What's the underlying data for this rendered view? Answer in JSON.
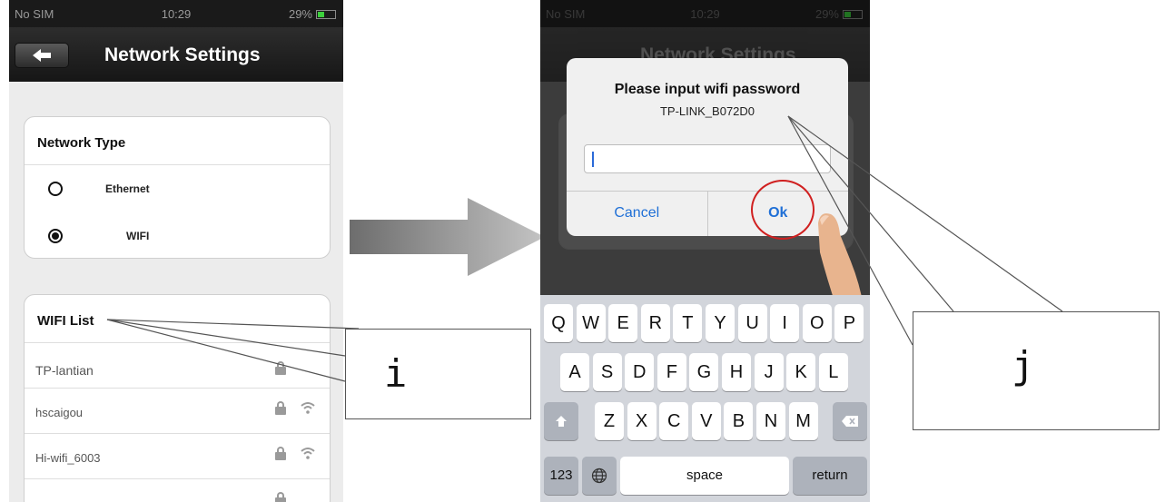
{
  "left_phone": {
    "status": {
      "carrier": "No SIM",
      "time": "10:29",
      "battery": "29%"
    },
    "nav": {
      "back_icon": "back-arrow-icon",
      "title": "Network Settings"
    },
    "network_type": {
      "heading": "Network Type",
      "options": [
        {
          "label": "Ethernet",
          "selected": false
        },
        {
          "label": "WIFI",
          "selected": true
        }
      ]
    },
    "wifi_list": {
      "heading": "WIFI List",
      "networks": [
        {
          "ssid": "TP-lantian"
        },
        {
          "ssid": "hscaigou"
        },
        {
          "ssid": "Hi-wifi_6003"
        }
      ]
    }
  },
  "right_phone": {
    "status": {
      "carrier": "No SIM",
      "time": "10:29",
      "battery": "29%"
    },
    "nav": {
      "title": "Network Settings"
    },
    "dialog": {
      "title": "Please input wifi password",
      "ssid": "TP-LINK_B072D0",
      "password_value": "",
      "cancel_label": "Cancel",
      "ok_label": "Ok"
    },
    "keyboard": {
      "row1": [
        "Q",
        "W",
        "E",
        "R",
        "T",
        "Y",
        "U",
        "I",
        "O",
        "P"
      ],
      "row2": [
        "A",
        "S",
        "D",
        "F",
        "G",
        "H",
        "J",
        "K",
        "L"
      ],
      "row3": [
        "Z",
        "X",
        "C",
        "V",
        "B",
        "N",
        "M"
      ],
      "numbers_label": "123",
      "space_label": "space",
      "return_label": "return"
    }
  },
  "callouts": {
    "i": "i",
    "j": "j"
  },
  "colors": {
    "accent": "#1f6fd6",
    "highlight_circle": "#d02020",
    "nav_bar": "#1a1a1a",
    "page_bg": "#ececec"
  }
}
